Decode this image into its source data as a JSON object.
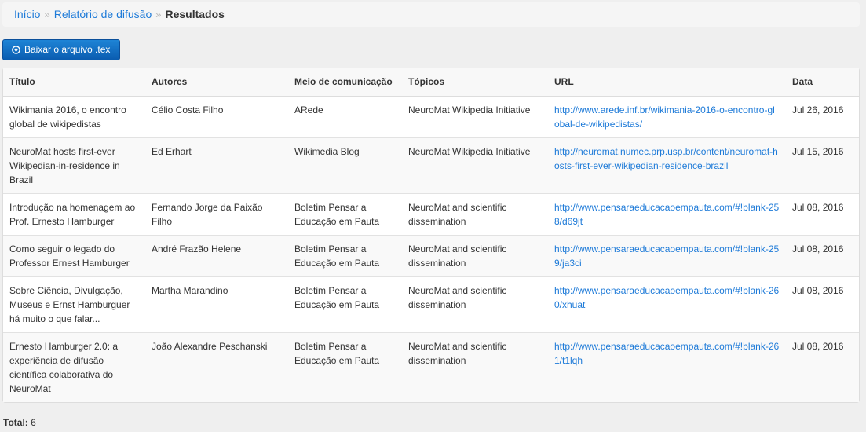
{
  "breadcrumb": {
    "items": [
      "Início",
      "Relatório de difusão"
    ],
    "separator": "»",
    "current": "Resultados"
  },
  "download_button": {
    "label": "Baixar o arquivo .tex",
    "icon": "circle-arrow-down-icon"
  },
  "table": {
    "columns": [
      "Título",
      "Autores",
      "Meio de comunicação",
      "Tópicos",
      "URL",
      "Data"
    ],
    "rows": [
      {
        "title": "Wikimania 2016, o encontro global de wikipedistas",
        "authors": "Célio Costa Filho",
        "medium": "ARede",
        "topics": "NeuroMat Wikipedia Initiative",
        "url": "http://www.arede.inf.br/wikimania-2016-o-encontro-global-de-wikipedistas/",
        "date": "Jul 26, 2016"
      },
      {
        "title": "NeuroMat hosts first-ever Wikipedian-in-residence in Brazil",
        "authors": "Ed Erhart",
        "medium": "Wikimedia Blog",
        "topics": "NeuroMat Wikipedia Initiative",
        "url": "http://neuromat.numec.prp.usp.br/content/neuromat-hosts-first-ever-wikipedian-residence-brazil",
        "date": "Jul 15, 2016"
      },
      {
        "title": "Introdução na homenagem ao Prof. Ernesto Hamburger",
        "authors": "Fernando Jorge da Paixão Filho",
        "medium": "Boletim Pensar a Educação em Pauta",
        "topics": "NeuroMat and scientific dissemination",
        "url": "http://www.pensaraeducacaoempauta.com/#!blank-258/d69jt",
        "date": "Jul 08, 2016"
      },
      {
        "title": "Como seguir o legado do Professor Ernest Hamburger",
        "authors": "André Frazão Helene",
        "medium": "Boletim Pensar a Educação em Pauta",
        "topics": "NeuroMat and scientific dissemination",
        "url": "http://www.pensaraeducacaoempauta.com/#!blank-259/ja3ci",
        "date": "Jul 08, 2016"
      },
      {
        "title": "Sobre Ciência, Divulgação, Museus e Ernst Hamburguer há muito o que falar...",
        "authors": "Martha Marandino",
        "medium": "Boletim Pensar a Educação em Pauta",
        "topics": "NeuroMat and scientific dissemination",
        "url": "http://www.pensaraeducacaoempauta.com/#!blank-260/xhuat",
        "date": "Jul 08, 2016"
      },
      {
        "title": "Ernesto Hamburger 2.0: a experiência de difusão científica colaborativa do NeuroMat",
        "authors": "João Alexandre Peschanski",
        "medium": "Boletim Pensar a Educação em Pauta",
        "topics": "NeuroMat and scientific dissemination",
        "url": "http://www.pensaraeducacaoempauta.com/#!blank-261/t1lqh",
        "date": "Jul 08, 2016"
      }
    ]
  },
  "footer": {
    "total_label": "Total:",
    "total_value": "6"
  },
  "colors": {
    "link": "#1d7ad8",
    "button": "#0a5cb0",
    "page_bg": "#efefef"
  }
}
